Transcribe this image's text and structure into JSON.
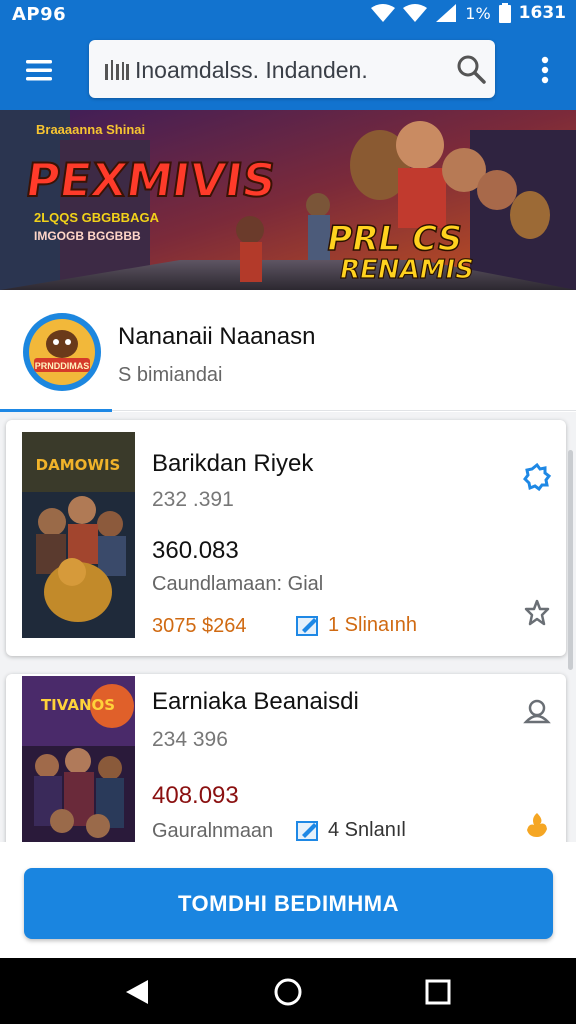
{
  "status_bar": {
    "left_text": "AP96",
    "battery_text": "1%",
    "time": "1631"
  },
  "app_bar": {
    "search_text": "Inoamdalss. Indanden."
  },
  "banner": {
    "logo_small": "Braaaanna Shinai",
    "title_left": "PEXMIVIS",
    "subtitle_1": "2LQQS  GBGBBAGA",
    "subtitle_2": "IMGOGB  BGGBBB",
    "title_right_1": "PRL CS",
    "title_right_2": "RENAMIS"
  },
  "profile": {
    "avatar_text": "PRNDDIMAS",
    "name": "Nananaii Naanasn",
    "subtitle": "S bimiandai"
  },
  "items": [
    {
      "title": "Barikdan Riyek",
      "code": "232 .391",
      "price": "360.083",
      "label": "Caundlamaan: Gial",
      "extra": "3075 $264",
      "badge_text": "1 Slinaınh",
      "poster_text": "DAMOWIS",
      "colors": {
        "price": "#111111",
        "badge": "#d06a12"
      }
    },
    {
      "title": "Earniaka Beanaisdi",
      "code": "234  396",
      "price": "408.093",
      "label": "Gauralnmaan",
      "badge_text": "4 Snlanıl",
      "poster_text": "TIVANOS",
      "colors": {
        "price": "#8a1010",
        "badge": "#333333"
      }
    }
  ],
  "cta": {
    "label": "TOMDHI BEDIMHMA"
  },
  "icons": [
    "menu-icon",
    "search-icon",
    "more-vert-icon",
    "settings-icon",
    "star-outline-icon",
    "person-outline-icon",
    "fire-icon",
    "edit-icon",
    "back-icon",
    "home-icon",
    "recents-icon"
  ],
  "theme": {
    "primary": "#1273cf",
    "accent": "#1e88e5",
    "orange": "#d06a12"
  }
}
